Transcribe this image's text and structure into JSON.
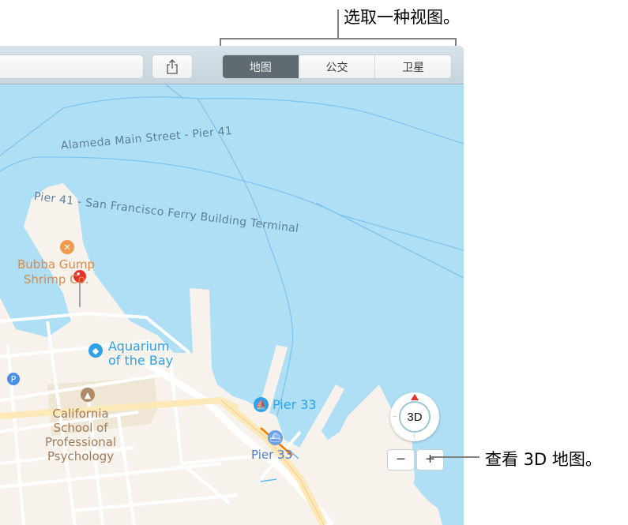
{
  "callouts": {
    "choose_view": "选取一种视图。",
    "view_3d": "查看 3D 地图。"
  },
  "toolbar": {
    "search_placeholder": "",
    "share_icon": "share-icon",
    "view_modes": [
      {
        "label": "地图",
        "selected": true
      },
      {
        "label": "公交",
        "selected": false
      },
      {
        "label": "卫星",
        "selected": false
      }
    ]
  },
  "map": {
    "ferry_routes": [
      {
        "label": "Alameda Main Street - Pier 41"
      },
      {
        "label": "Pier 41 - San Francisco Ferry Building Terminal"
      }
    ],
    "pois": {
      "restaurant": {
        "name_line1": "Bubba Gump",
        "name_line2": "Shrimp Co.",
        "icon": "fork-knife-icon"
      },
      "aquarium": {
        "name_line1": "Aquarium",
        "name_line2": "of the Bay",
        "icon": "dolphin-icon"
      },
      "school": {
        "line1": "California",
        "line2": "School of",
        "line3": "Professional",
        "line4": "Psychology",
        "icon": "graduation-cap-icon"
      },
      "marina": {
        "name": "Pier 33",
        "icon": "sailboat-icon"
      },
      "ferry_terminal": {
        "name": "Pier 33",
        "icon": "ship-icon"
      },
      "parking": {
        "glyph": "P"
      }
    },
    "colors": {
      "water": "#aedff5",
      "land": "#f7f3ec",
      "road_major": "#fde8b8",
      "route_line": "#7ec4f0",
      "pin": "#e8302a"
    }
  },
  "controls": {
    "compass_label": "3D",
    "zoom_out": "−",
    "zoom_in": "+"
  }
}
